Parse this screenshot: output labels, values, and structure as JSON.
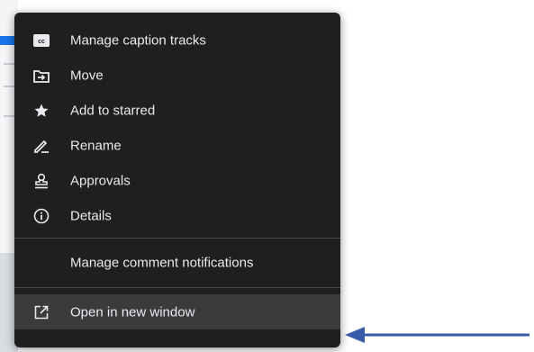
{
  "menu": {
    "section1": [
      {
        "label": "Manage caption tracks",
        "icon": "closed-caption-icon"
      },
      {
        "label": "Move",
        "icon": "move-folder-icon"
      },
      {
        "label": "Add to starred",
        "icon": "star-icon"
      },
      {
        "label": "Rename",
        "icon": "pencil-icon"
      },
      {
        "label": "Approvals",
        "icon": "stamp-icon"
      },
      {
        "label": "Details",
        "icon": "info-icon"
      }
    ],
    "section2": [
      {
        "label": "Manage comment notifications"
      }
    ],
    "section3": [
      {
        "label": "Open in new window",
        "icon": "open-in-new-icon",
        "highlighted": true
      }
    ]
  },
  "colors": {
    "menu_background": "#1f1f1f",
    "menu_text": "#e8eaed",
    "highlight": "#3a3b3d",
    "arrow": "#3a5ba9"
  },
  "annotation": {
    "icon": "arrow-left-icon"
  }
}
